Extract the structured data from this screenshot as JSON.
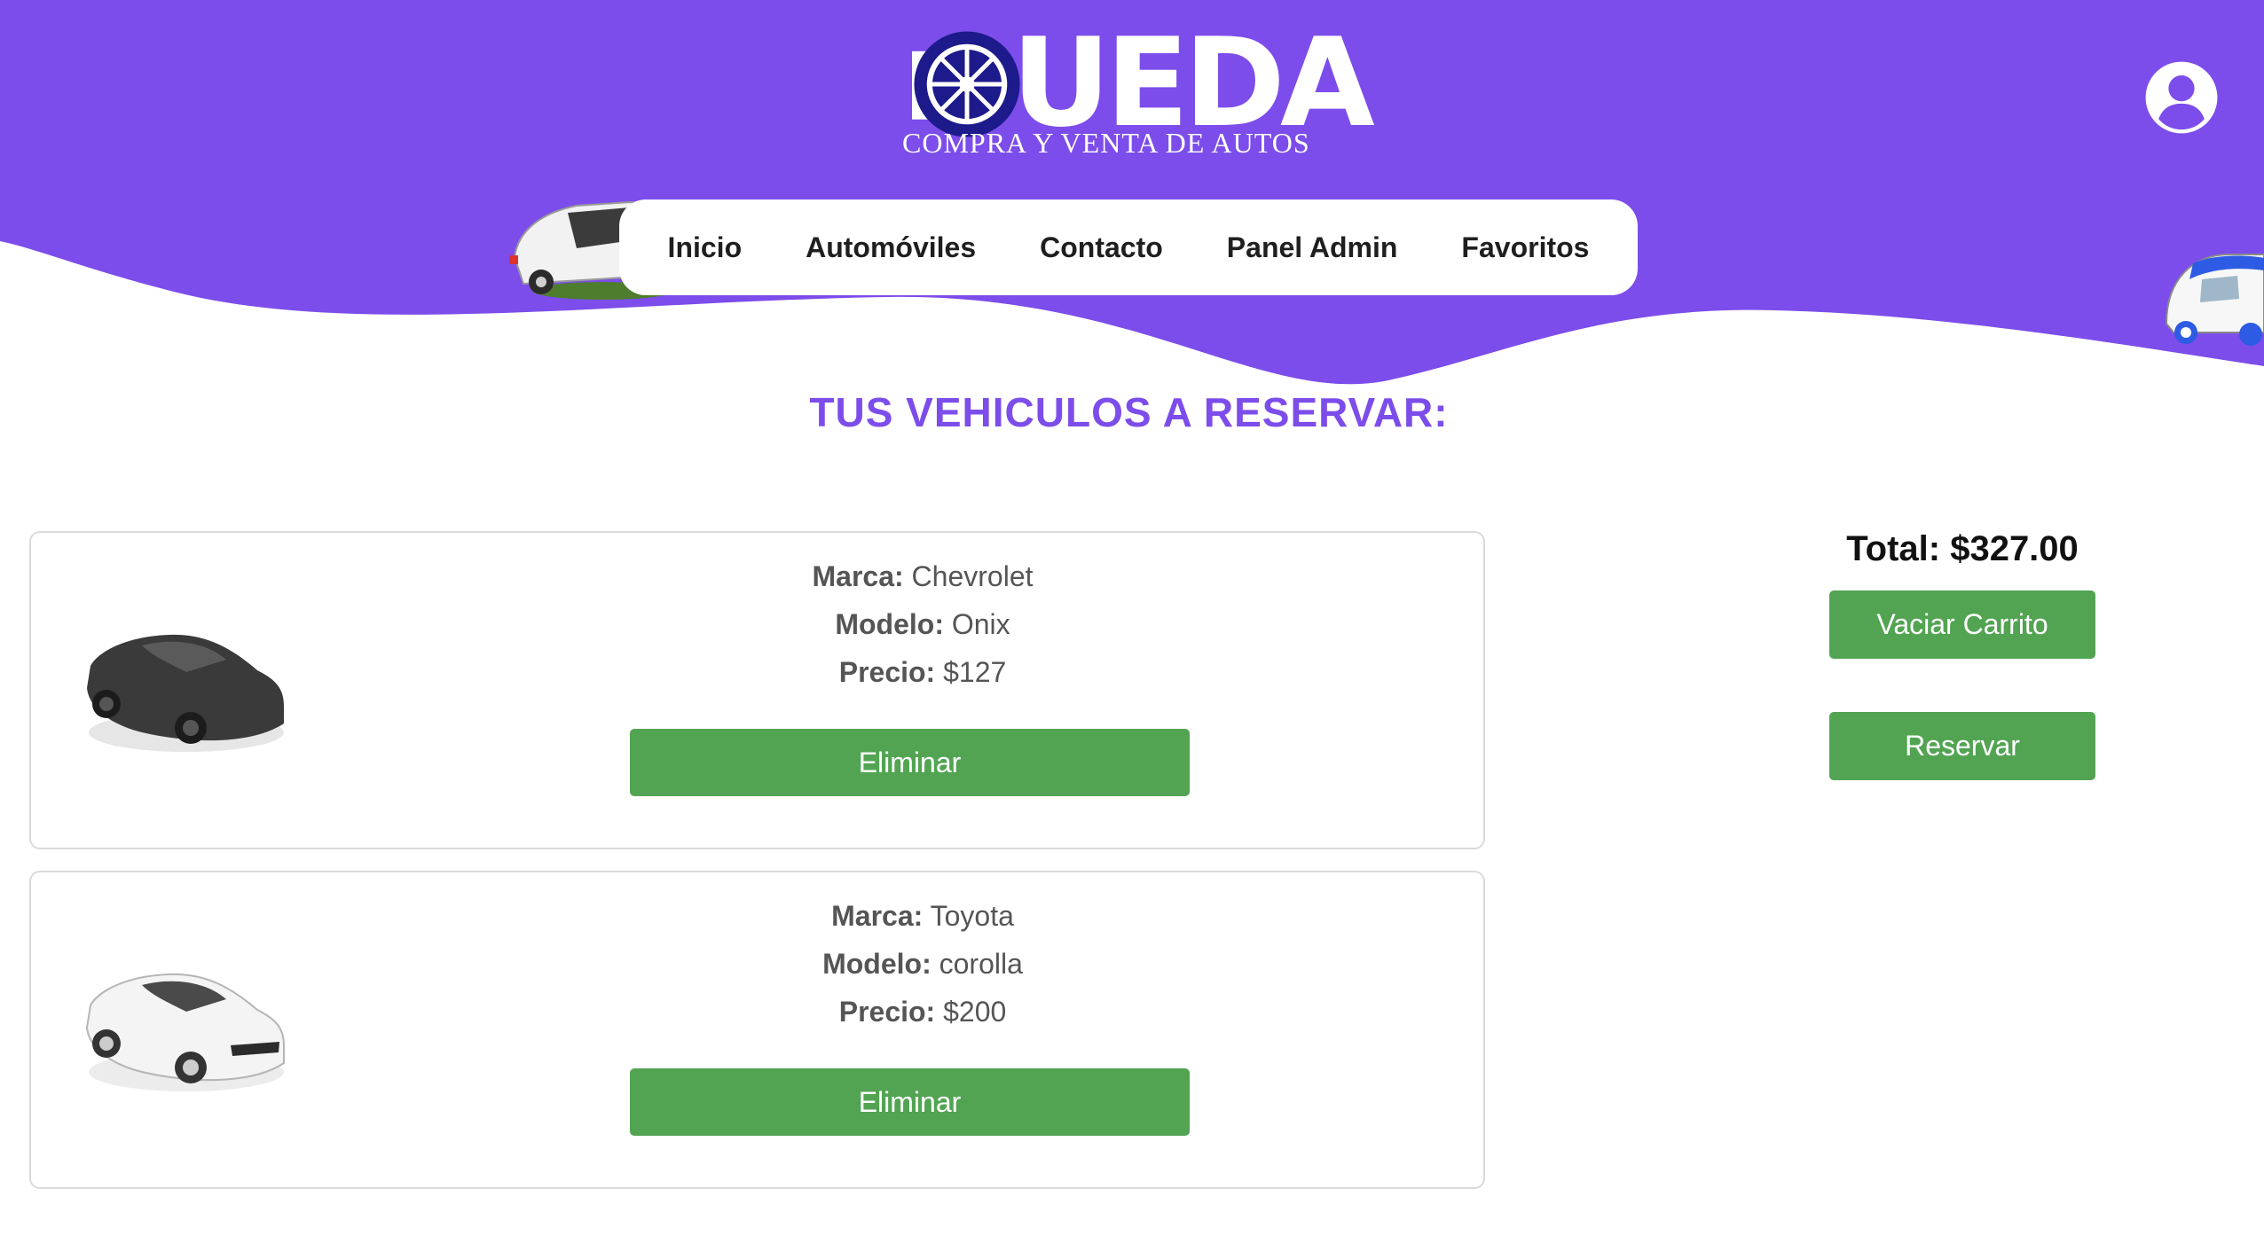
{
  "brand": {
    "name": "UEDA",
    "tagline": "COMPRA Y VENTA DE AUTOS",
    "primary_color": "#7c4dea",
    "logo_wheel_color": "#1d1a8c"
  },
  "nav": {
    "items": [
      {
        "label": "Inicio"
      },
      {
        "label": "Automóviles"
      },
      {
        "label": "Contacto"
      },
      {
        "label": "Panel Admin"
      },
      {
        "label": "Favoritos"
      }
    ]
  },
  "header": {
    "account_icon": "user-circle-icon"
  },
  "page": {
    "title": "TUS VEHICULOS A RESERVAR:"
  },
  "cart": {
    "items": [
      {
        "brand_label": "Marca:",
        "brand": "Chevrolet",
        "model_label": "Modelo:",
        "model": "Onix",
        "price_label": "Precio:",
        "price": "$127",
        "color": "#3a3a3a",
        "remove_label": "Eliminar"
      },
      {
        "brand_label": "Marca:",
        "brand": "Toyota",
        "model_label": "Modelo:",
        "model": "corolla",
        "price_label": "Precio:",
        "price": "$200",
        "color": "#f4f4f4",
        "remove_label": "Eliminar"
      }
    ],
    "total": "Total: $327.00",
    "empty_label": "Vaciar Carrito",
    "reserve_label": "Reservar",
    "button_color": "#52a452"
  }
}
